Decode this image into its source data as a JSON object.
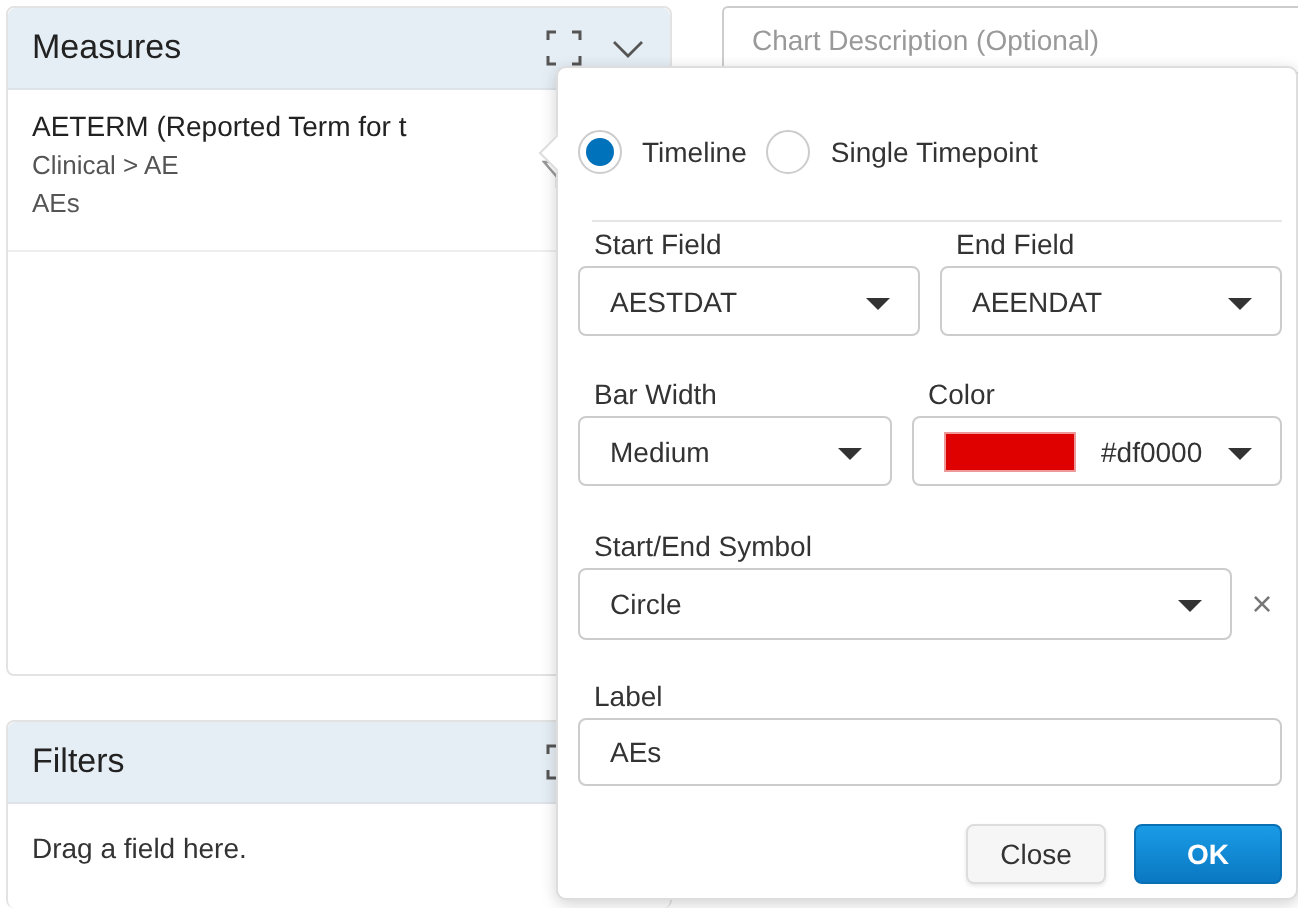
{
  "measures": {
    "title": "Measures",
    "items": [
      {
        "name": "AETERM (Reported Term for t",
        "path": "Clinical > AE",
        "label": "AEs"
      }
    ]
  },
  "filters": {
    "title": "Filters",
    "hint": "Drag a field here."
  },
  "chart_description": {
    "placeholder": "Chart Description (Optional)"
  },
  "popup": {
    "modes": [
      {
        "label": "Timeline",
        "selected": true
      },
      {
        "label": "Single Timepoint",
        "selected": false
      }
    ],
    "start_field": {
      "label": "Start Field",
      "value": "AESTDAT"
    },
    "end_field": {
      "label": "End Field",
      "value": "AEENDAT"
    },
    "bar_width": {
      "label": "Bar Width",
      "value": "Medium"
    },
    "color": {
      "label": "Color",
      "value": "#df0000",
      "color": "#df0000"
    },
    "symbol": {
      "label": "Start/End Symbol",
      "value": "Circle",
      "clear": "×"
    },
    "label": {
      "label": "Label",
      "value": "AEs"
    },
    "buttons": [
      {
        "label": "Close",
        "kind": "secondary"
      },
      {
        "label": "OK",
        "kind": "primary"
      }
    ]
  }
}
